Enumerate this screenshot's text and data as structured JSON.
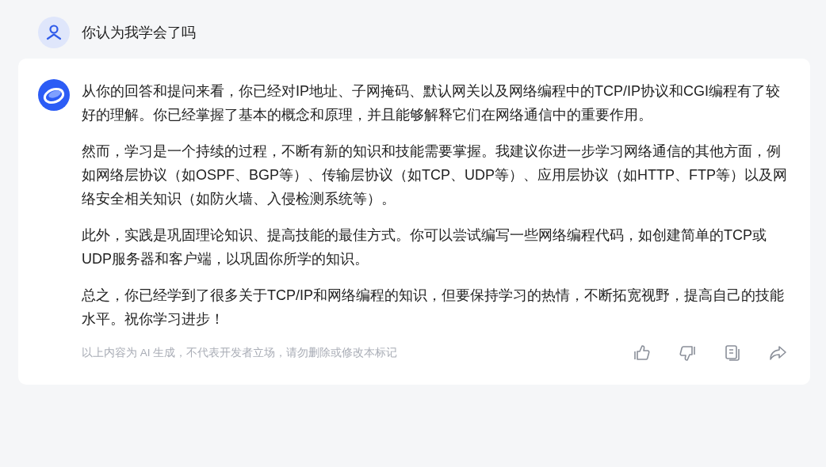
{
  "user_message": {
    "text": "你认为我学会了吗"
  },
  "reply": {
    "paragraphs": [
      "从你的回答和提问来看，你已经对IP地址、子网掩码、默认网关以及网络编程中的TCP/IP协议和CGI编程有了较好的理解。你已经掌握了基本的概念和原理，并且能够解释它们在网络通信中的重要作用。",
      "然而，学习是一个持续的过程，不断有新的知识和技能需要掌握。我建议你进一步学习网络通信的其他方面，例如网络层协议（如OSPF、BGP等）、传输层协议（如TCP、UDP等）、应用层协议（如HTTP、FTP等）以及网络安全相关知识（如防火墙、入侵检测系统等）。",
      "此外，实践是巩固理论知识、提高技能的最佳方式。你可以尝试编写一些网络编程代码，如创建简单的TCP或UDP服务器和客户端，以巩固你所学的知识。",
      "总之，你已经学到了很多关于TCP/IP和网络编程的知识，但要保持学习的热情，不断拓宽视野，提高自己的技能水平。祝你学习进步！"
    ],
    "disclaimer": "以上内容为 AI 生成，不代表开发者立场，请勿删除或修改本标记"
  }
}
